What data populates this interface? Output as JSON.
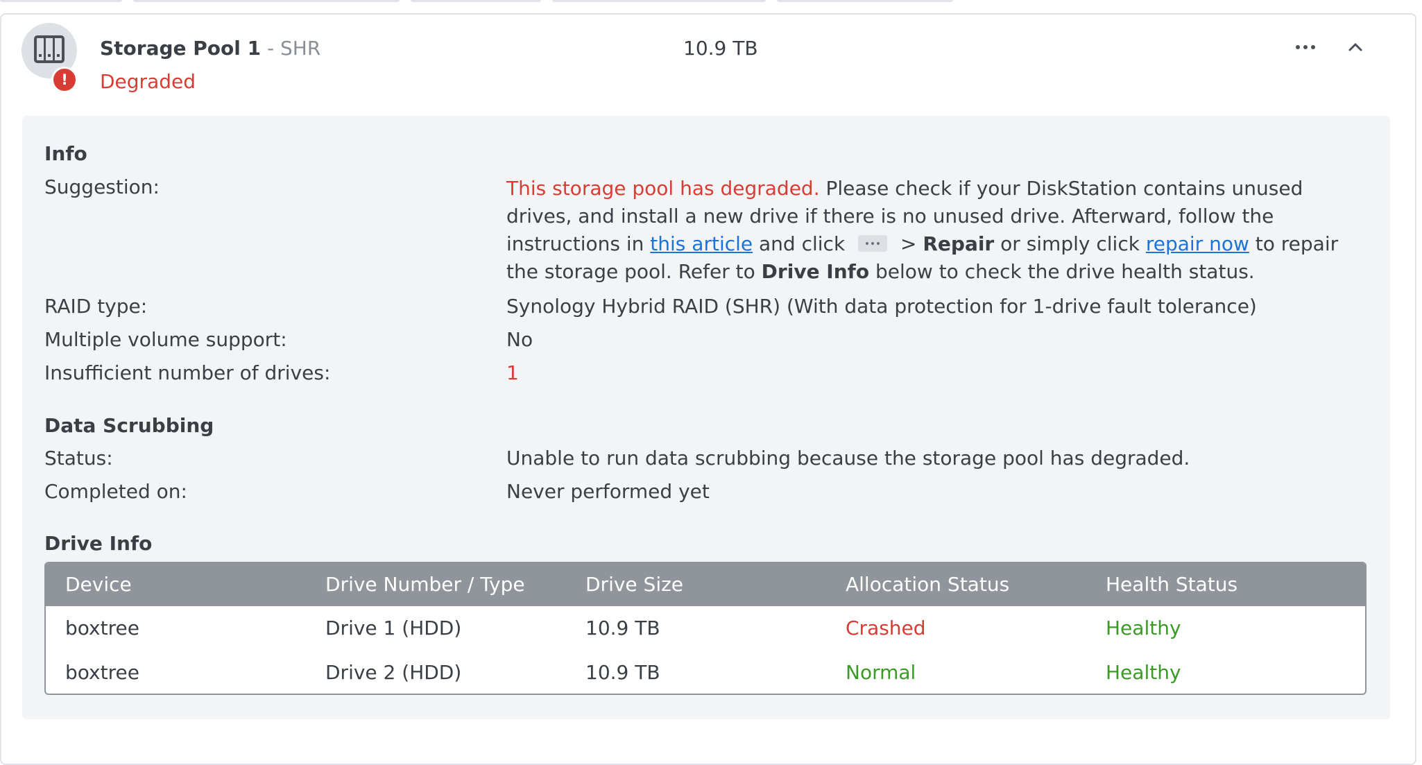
{
  "pool": {
    "name": "Storage Pool 1",
    "separator": " - ",
    "raid_short": "SHR",
    "status": "Degraded",
    "size": "10.9 TB",
    "alert_glyph": "!",
    "icon": "nas-drive-bays-icon",
    "status_color": "#d83c34"
  },
  "info": {
    "title": "Info",
    "suggestion_label": "Suggestion:",
    "suggestion": {
      "warning": "This storage pool has degraded.",
      "text1": " Please check if your DiskStation contains unused drives, and install a new drive if there is no unused drive. Afterward, follow the instructions in ",
      "link_article": "this article",
      "text2": " and click ",
      "text3": " > ",
      "repair_bold": "Repair",
      "text4": " or simply click ",
      "link_repair": "repair now",
      "text5": " to repair the storage pool. Refer to ",
      "drive_info_bold": "Drive Info",
      "text6": " below to check the drive health status."
    },
    "raid_type_label": "RAID type:",
    "raid_type_value": "Synology Hybrid RAID (SHR) (With data protection for 1-drive fault tolerance)",
    "multi_volume_label": "Multiple volume support:",
    "multi_volume_value": "No",
    "insufficient_label": "Insufficient number of drives:",
    "insufficient_value": "1"
  },
  "scrubbing": {
    "title": "Data Scrubbing",
    "status_label": "Status:",
    "status_value": "Unable to run data scrubbing because the storage pool has degraded.",
    "completed_label": "Completed on:",
    "completed_value": "Never performed yet"
  },
  "drive_info": {
    "title": "Drive Info",
    "columns": [
      "Device",
      "Drive Number / Type",
      "Drive Size",
      "Allocation Status",
      "Health Status"
    ],
    "rows": [
      {
        "device": "boxtree",
        "drive": "Drive 1 (HDD)",
        "size": "10.9 TB",
        "allocation": "Crashed",
        "health": "Healthy"
      },
      {
        "device": "boxtree",
        "drive": "Drive 2 (HDD)",
        "size": "10.9 TB",
        "allocation": "Normal",
        "health": "Healthy"
      }
    ]
  },
  "colors": {
    "error": "#d83c34",
    "ok": "#3a9a25",
    "link": "#1a73d9",
    "table_header": "#8f959b"
  }
}
